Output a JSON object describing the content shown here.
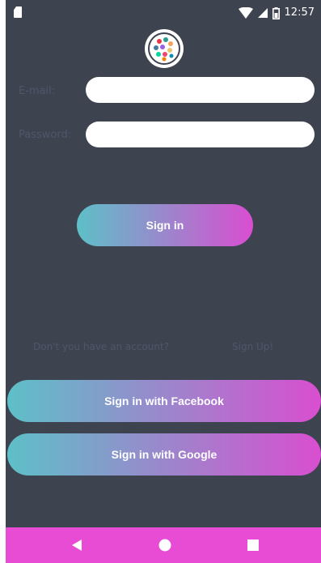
{
  "status_bar": {
    "time": "12:57",
    "icons": [
      "sim-card-icon",
      "wifi-icon",
      "signal-icon",
      "battery-icon"
    ]
  },
  "logo": {
    "icon": "globe-people-logo"
  },
  "form": {
    "email_label": "E-mail:",
    "email_value": "",
    "password_label": "Password:",
    "password_value": ""
  },
  "sign_in_label": "Sign in",
  "signup_prompt": {
    "question": "Don't you have an account?",
    "link": "Sign Up!"
  },
  "social": {
    "facebook_label": "Sign in with Facebook",
    "google_label": "Sign in with Google"
  },
  "nav_bar": {
    "icons": [
      "back-icon",
      "home-icon",
      "recents-icon"
    ]
  },
  "colors": {
    "background": "#3e4350",
    "gradient_start": "#5dc0c8",
    "gradient_end": "#d94ed0",
    "nav_bar": "#e84bd4",
    "muted_text": "#50566a"
  }
}
